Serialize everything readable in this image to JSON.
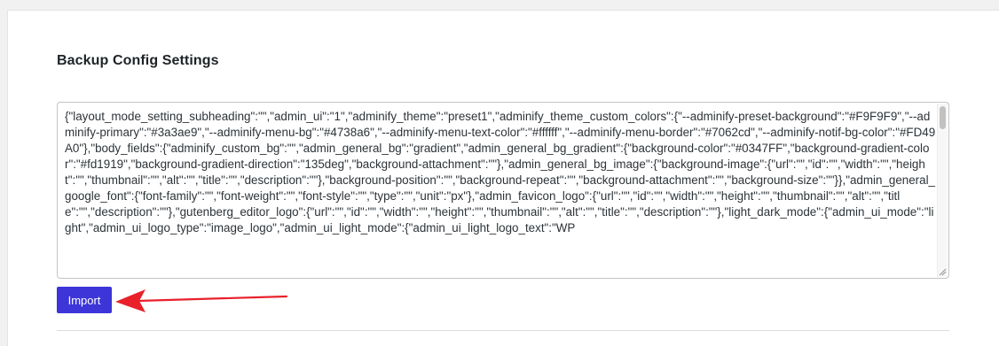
{
  "section": {
    "title": "Backup Config Settings"
  },
  "config_textarea": {
    "value": "{\"layout_mode_setting_subheading\":\"\",\"admin_ui\":\"1\",\"adminify_theme\":\"preset1\",\"adminify_theme_custom_colors\":{\"--adminify-preset-background\":\"#F9F9F9\",\"--adminify-primary\":\"#3a3ae9\",\"--adminify-menu-bg\":\"#4738a6\",\"--adminify-menu-text-color\":\"#ffffff\",\"--adminify-menu-border\":\"#7062cd\",\"--adminify-notif-bg-color\":\"#FD49A0\"},\"body_fields\":{\"adminify_custom_bg\":\"\",\"admin_general_bg\":\"gradient\",\"admin_general_bg_gradient\":{\"background-color\":\"#0347FF\",\"background-gradient-color\":\"#fd1919\",\"background-gradient-direction\":\"135deg\",\"background-attachment\":\"\"},\"admin_general_bg_image\":{\"background-image\":{\"url\":\"\",\"id\":\"\",\"width\":\"\",\"height\":\"\",\"thumbnail\":\"\",\"alt\":\"\",\"title\":\"\",\"description\":\"\"},\"background-position\":\"\",\"background-repeat\":\"\",\"background-attachment\":\"\",\"background-size\":\"\"}},\"admin_general_google_font\":{\"font-family\":\"\",\"font-weight\":\"\",\"font-style\":\"\",\"type\":\"\",\"unit\":\"px\"},\"admin_favicon_logo\":{\"url\":\"\",\"id\":\"\",\"width\":\"\",\"height\":\"\",\"thumbnail\":\"\",\"alt\":\"\",\"title\":\"\",\"description\":\"\"},\"gutenberg_editor_logo\":{\"url\":\"\",\"id\":\"\",\"width\":\"\",\"height\":\"\",\"thumbnail\":\"\",\"alt\":\"\",\"title\":\"\",\"description\":\"\"},\"light_dark_mode\":{\"admin_ui_mode\":\"light\",\"admin_ui_logo_type\":\"image_logo\",\"admin_ui_light_mode\":{\"admin_ui_light_logo_text\":\"WP"
  },
  "actions": {
    "import_label": "Import"
  },
  "colors": {
    "primary_button": "#3d35d8",
    "annotation_arrow": "#e8212b"
  },
  "icons": {
    "scrollbar": "scrollbar-thumb",
    "resize": "resize-grip-icon",
    "annotation": "red-arrow-icon"
  }
}
